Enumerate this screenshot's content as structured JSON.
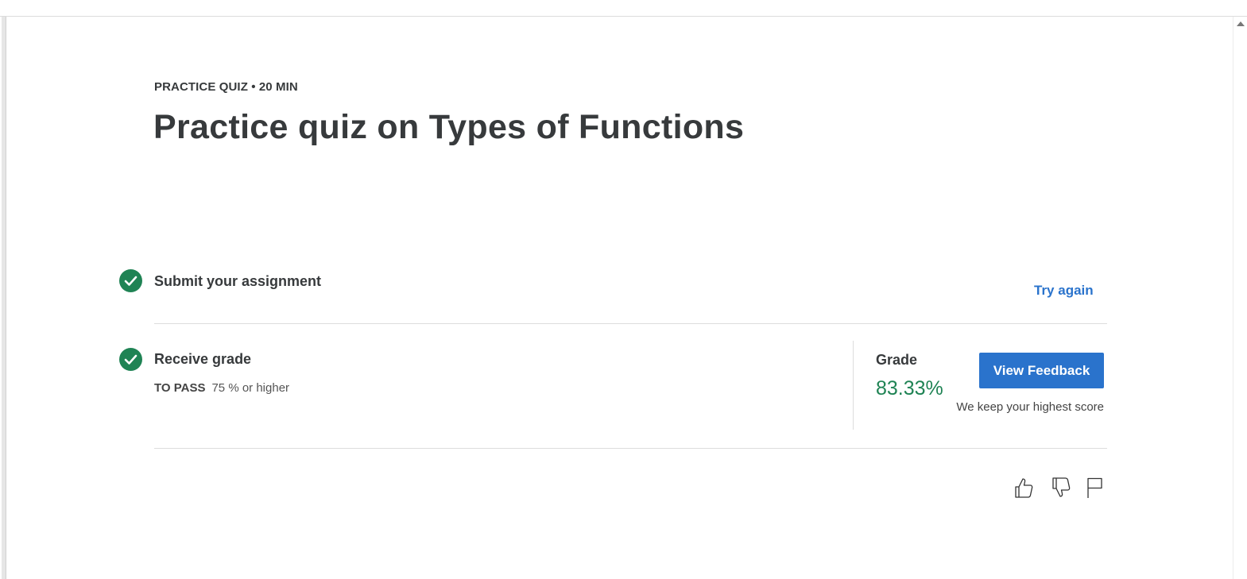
{
  "header": {
    "eyebrow": "PRACTICE QUIZ • 20 MIN",
    "title": "Practice quiz on Types of Functions"
  },
  "steps": {
    "submit": {
      "title": "Submit your assignment",
      "action_label": "Try again"
    },
    "receive": {
      "title": "Receive grade",
      "to_pass_label": "TO PASS",
      "to_pass_value": "75 % or higher"
    }
  },
  "grade": {
    "label": "Grade",
    "value": "83.33%",
    "button_label": "View Feedback",
    "note": "We keep your highest score"
  },
  "feedback_icons": [
    "thumbs-up-icon",
    "thumbs-down-icon",
    "flag-icon"
  ],
  "colors": {
    "accent_blue": "#2a73cc",
    "success_green": "#1f8354",
    "text_dark": "#373a3c",
    "divider": "#dcdcdc"
  }
}
